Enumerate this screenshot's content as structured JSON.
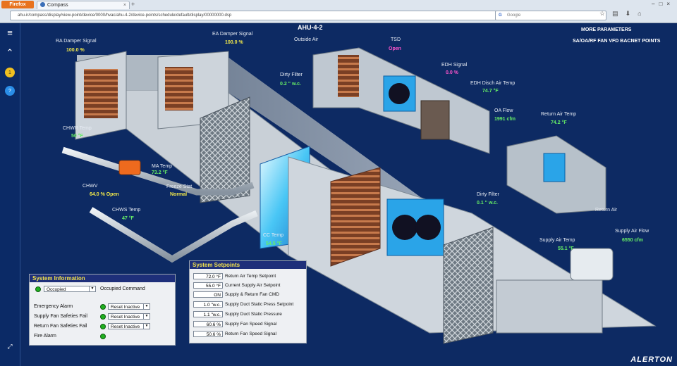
{
  "browser": {
    "app_button": "Firefox",
    "tab_title": "Compass",
    "url": "ahu-ir/compass/display/view-point/device/0000/hvac/ahu-4-2/device-points/schedule/default/display/00000000.dsp",
    "search_placeholder": "Google"
  },
  "page": {
    "title": "AHU-4-2",
    "links": [
      "MORE PARAMETERS",
      "SA/OA/RF FAN VFD BACNET POINTS"
    ],
    "logo": "ALERTON"
  },
  "points": [
    {
      "label": "RA Damper Signal",
      "value": "100.0 %",
      "color": "#f1e84b"
    },
    {
      "label": "EA Damper Signal",
      "value": "100.0 %",
      "color": "#f1e84b"
    },
    {
      "label": "Outside Air",
      "value": "",
      "color": ""
    },
    {
      "label": "TSD",
      "value": "Open",
      "color": "#ff55cc"
    },
    {
      "label": "EDH Signal",
      "value": "0.0 %",
      "color": "#ff55cc"
    },
    {
      "label": "Dirty Filter",
      "value": "0.2 \" w.c.",
      "color": "#66ee66"
    },
    {
      "label": "EDH Disch Air Temp",
      "value": "74.7 °F",
      "color": "#66ee66"
    },
    {
      "label": "OA Flow",
      "value": "1991 cfm",
      "color": "#66ee66"
    },
    {
      "label": "Return Air Temp",
      "value": "74.2 °F",
      "color": "#66ee66"
    },
    {
      "label": "CHWR Temp",
      "value": "50 °F",
      "color": "#66ee66"
    },
    {
      "label": "MA Temp",
      "value": "73.2 °F",
      "color": "#66ee66"
    },
    {
      "label": "Freeze Stat",
      "value": "Normal",
      "color": "#f1e84b"
    },
    {
      "label": "CHWV",
      "value": "64.0 % Open",
      "color": "#f1e84b"
    },
    {
      "label": "CHWS Temp",
      "value": "47 °F",
      "color": "#66ee66"
    },
    {
      "label": "Dirty Filter",
      "value": "0.1 \" w.c.",
      "color": "#66ee66"
    },
    {
      "label": "Return Air",
      "value": "",
      "color": ""
    },
    {
      "label": "CC Temp",
      "value": "54.5 °F",
      "color": "#66ee66"
    },
    {
      "label": "Supply Air Temp",
      "value": "55.1 °F",
      "color": "#66ee66"
    },
    {
      "label": "Supply Air Flow",
      "value": "6550 cfm",
      "color": "#66ee66"
    }
  ],
  "system_info": {
    "title": "System Information",
    "mode_value": "Occupied",
    "mode_label": "Occupied Command",
    "rows": [
      {
        "label": "Emergency Alarm",
        "value": "Reset Inactive"
      },
      {
        "label": "Supply Fan Safeties Fail",
        "value": "Reset Inactive"
      },
      {
        "label": "Return Fan Safeties Fail",
        "value": "Reset Inactive"
      },
      {
        "label": "Fire Alarm",
        "value": ""
      }
    ]
  },
  "setpoints": {
    "title": "System Setpoints",
    "rows": [
      {
        "value": "72.0 °F",
        "label": "Return Air Temp Setpoint"
      },
      {
        "value": "55.0 °F",
        "label": "Current Supply Air Setpoint"
      },
      {
        "value": "ON",
        "label": "Supply & Return Fan CMD"
      },
      {
        "value": "1.0 \"w.c.",
        "label": "Supply Duct Static Press Setpoint"
      },
      {
        "value": "1.1 \"w.c.",
        "label": "Supply Duct Static Pressure"
      },
      {
        "value": "60.6 %",
        "label": "Supply Fan Speed Signal"
      },
      {
        "value": "50.6 %",
        "label": "Return Fan Speed Signal"
      }
    ]
  }
}
